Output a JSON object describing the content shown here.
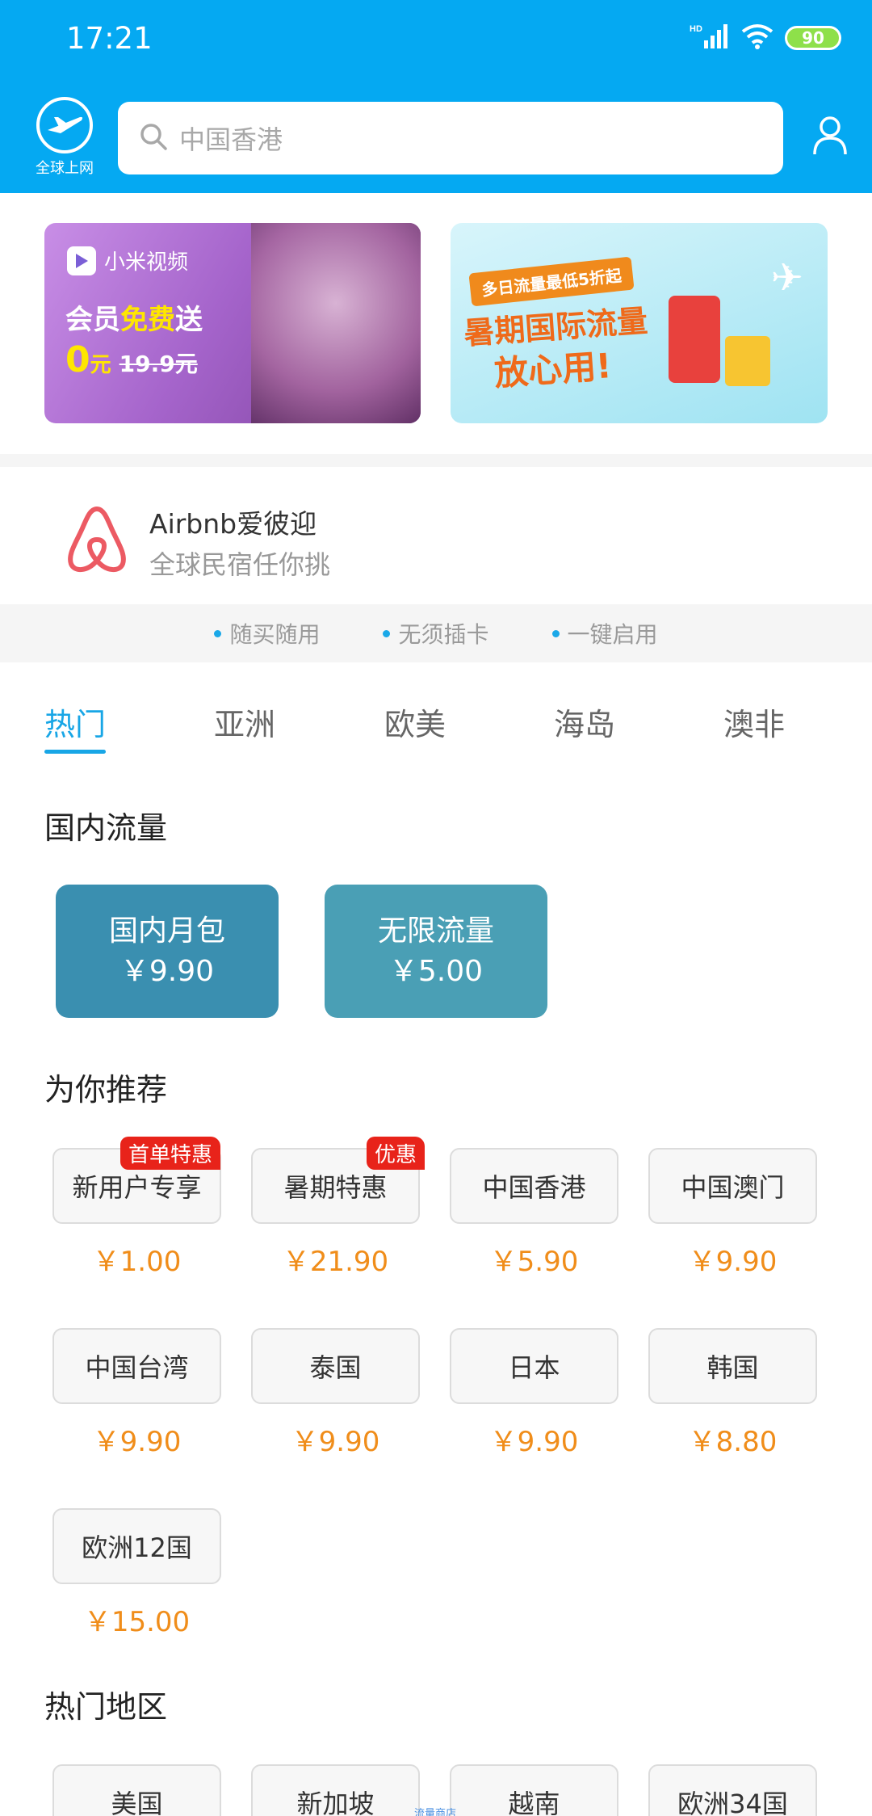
{
  "status_bar": {
    "time": "17:21",
    "network": "HD",
    "battery": "90"
  },
  "header": {
    "logo_text": "全球上网",
    "search_placeholder": "中国香港"
  },
  "banners": [
    {
      "brand": "小米视频",
      "line1_a": "会员",
      "line1_b": "免费",
      "line1_c": "送",
      "price_new": "0",
      "price_new_unit": "元",
      "price_old": "19.9元"
    },
    {
      "tag": "多日流量最低5折起",
      "title1": "暑期国际流量",
      "title2": "放心用!"
    }
  ],
  "promo": {
    "title": "Airbnb爱彼迎",
    "subtitle": "全球民宿任你挑"
  },
  "features": [
    "随买随用",
    "无须插卡",
    "一键启用"
  ],
  "tabs": [
    {
      "label": "热门",
      "active": true
    },
    {
      "label": "亚洲",
      "active": false
    },
    {
      "label": "欧美",
      "active": false
    },
    {
      "label": "海岛",
      "active": false
    },
    {
      "label": "澳非",
      "active": false
    }
  ],
  "sections": {
    "domestic": "国内流量",
    "recommend": "为你推荐",
    "hot": "热门地区"
  },
  "domestic": [
    {
      "name": "国内月包",
      "price": "￥9.90",
      "color": "#3a8fb0"
    },
    {
      "name": "无限流量",
      "price": "￥5.00",
      "color": "#4a9fb5"
    }
  ],
  "recommend": [
    {
      "name": "新用户专享",
      "price": "￥1.00",
      "badge": "首单特惠"
    },
    {
      "name": "暑期特惠",
      "price": "￥21.90",
      "badge": "优惠"
    },
    {
      "name": "中国香港",
      "price": "￥5.90",
      "badge": ""
    },
    {
      "name": "中国澳门",
      "price": "￥9.90",
      "badge": ""
    },
    {
      "name": "中国台湾",
      "price": "￥9.90",
      "badge": ""
    },
    {
      "name": "泰国",
      "price": "￥9.90",
      "badge": ""
    },
    {
      "name": "日本",
      "price": "￥9.90",
      "badge": ""
    },
    {
      "name": "韩国",
      "price": "￥8.80",
      "badge": ""
    },
    {
      "name": "欧洲12国",
      "price": "￥15.00",
      "badge": ""
    }
  ],
  "hot_regions": [
    "美国",
    "新加坡",
    "越南",
    "欧洲34国"
  ],
  "watermark": "流量商店",
  "colors": {
    "header": "#05a9f2",
    "accent": "#18a6e6",
    "price": "#f08d1a",
    "badge": "#e8231a"
  }
}
